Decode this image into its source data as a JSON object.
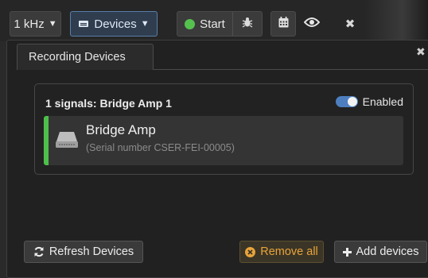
{
  "toolbar": {
    "freq_label": "1 kHz",
    "devices_label": "Devices",
    "start_label": "Start",
    "icons": [
      "chevron-down-icon",
      "devices-icon",
      "status-dot-icon",
      "bug-icon",
      "calendar-icon",
      "eye-icon",
      "close-icon"
    ]
  },
  "panel": {
    "tab_label": "Recording Devices",
    "group": {
      "title": "1 signals: Bridge Amp 1",
      "toggle_label": "Enabled",
      "toggle_on": true,
      "device": {
        "name": "Bridge Amp",
        "serial": "(Serial number CSER-FEI-00005)"
      }
    },
    "buttons": {
      "refresh": "Refresh Devices",
      "remove_all": "Remove all",
      "add": "Add devices"
    }
  },
  "colors": {
    "accent_blue": "#4d7fc0",
    "status_green": "#4cc04a",
    "warning_orange": "#e9a43a"
  }
}
